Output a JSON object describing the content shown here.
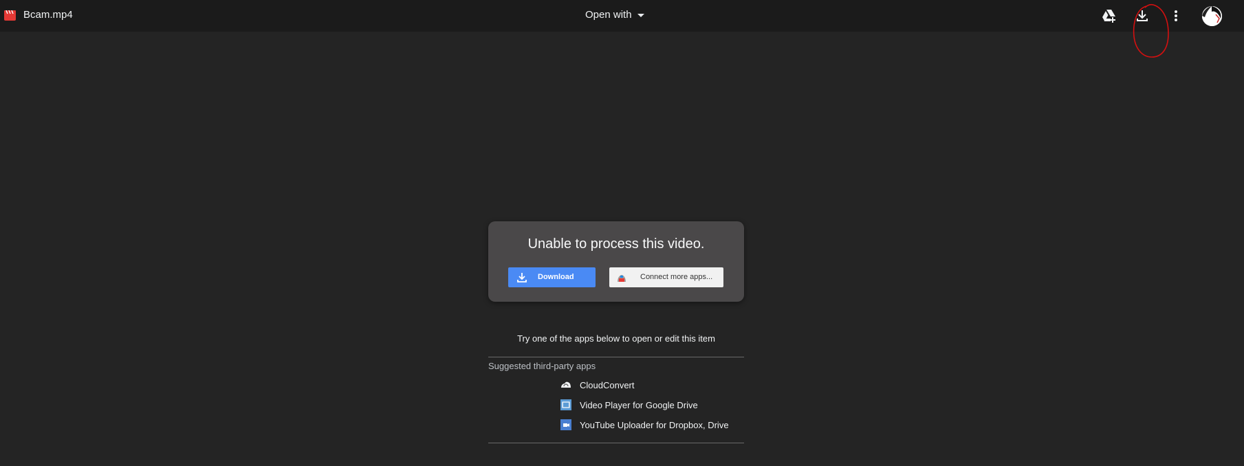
{
  "header": {
    "file_name": "Bcam.mp4",
    "open_with_label": "Open with",
    "icons": [
      "video-file-icon",
      "add-to-drive-icon",
      "download-icon",
      "more-vert-icon",
      "account-avatar"
    ]
  },
  "panel": {
    "title": "Unable to process this video.",
    "download_label": "Download",
    "connect_label": "Connect more apps..."
  },
  "apps_section": {
    "intro": "Try one of the apps below to open or edit this item",
    "suggested_label": "Suggested third-party apps",
    "apps": [
      {
        "name": "CloudConvert",
        "icon": "cloudconvert-icon"
      },
      {
        "name": "Video Player for Google Drive",
        "icon": "video-player-icon"
      },
      {
        "name": "YouTube Uploader for Dropbox, Drive",
        "icon": "youtube-uploader-icon"
      }
    ]
  },
  "colors": {
    "background": "#242424",
    "topbar": "#1b1b1b",
    "panel": "#4a4849",
    "primary_button": "#4a8af4",
    "annotation": "#d41010"
  }
}
